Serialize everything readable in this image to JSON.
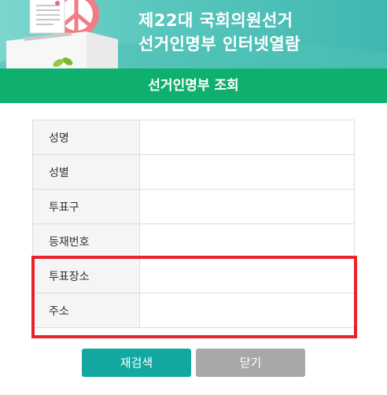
{
  "header": {
    "title_line1": "제22대 국회의원선거",
    "title_line2": "선거인명부 인터넷열람"
  },
  "section_title": "선거인명부 조회",
  "fields": [
    {
      "label": "성명",
      "value": ""
    },
    {
      "label": "성별",
      "value": ""
    },
    {
      "label": "투표구",
      "value": ""
    },
    {
      "label": "등재번호",
      "value": ""
    },
    {
      "label": "투표장소",
      "value": ""
    },
    {
      "label": "주소",
      "value": ""
    }
  ],
  "buttons": {
    "research_label": "재검색",
    "close_label": "닫기"
  },
  "colors": {
    "header_teal": "#4fbfb6",
    "green_bar": "#0fb06e",
    "highlight_red": "#e8232a",
    "button_teal": "#12a8a1",
    "button_gray": "#a8a8a8"
  }
}
